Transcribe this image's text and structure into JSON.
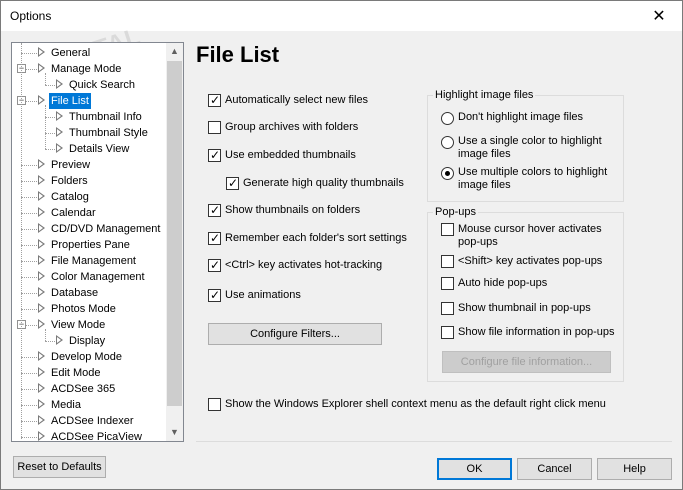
{
  "window": {
    "title": "Options",
    "close_glyph": "✕"
  },
  "watermark": "PORTAL",
  "tree": {
    "items": [
      {
        "label": "General",
        "level": 0
      },
      {
        "label": "Manage Mode",
        "level": 0,
        "expander": "−"
      },
      {
        "label": "Quick Search",
        "level": 1
      },
      {
        "label": "File List",
        "level": 0,
        "expander": "−",
        "selected": true
      },
      {
        "label": "Thumbnail Info",
        "level": 1
      },
      {
        "label": "Thumbnail Style",
        "level": 1
      },
      {
        "label": "Details View",
        "level": 1
      },
      {
        "label": "Preview",
        "level": 0
      },
      {
        "label": "Folders",
        "level": 0
      },
      {
        "label": "Catalog",
        "level": 0
      },
      {
        "label": "Calendar",
        "level": 0
      },
      {
        "label": "CD/DVD Management",
        "level": 0
      },
      {
        "label": "Properties Pane",
        "level": 0
      },
      {
        "label": "File Management",
        "level": 0
      },
      {
        "label": "Color Management",
        "level": 0
      },
      {
        "label": "Database",
        "level": 0
      },
      {
        "label": "Photos Mode",
        "level": 0
      },
      {
        "label": "View Mode",
        "level": 0,
        "expander": "−"
      },
      {
        "label": "Display",
        "level": 1
      },
      {
        "label": "Develop Mode",
        "level": 0
      },
      {
        "label": "Edit Mode",
        "level": 0
      },
      {
        "label": "ACDSee 365",
        "level": 0
      },
      {
        "label": "Media",
        "level": 0
      },
      {
        "label": "ACDSee Indexer",
        "level": 0
      },
      {
        "label": "ACDSee PicaView",
        "level": 0
      }
    ],
    "scroll_up": "▲",
    "scroll_down": "▼"
  },
  "page": {
    "title": "File List"
  },
  "options": {
    "auto_select_new": {
      "label": "Automatically select new files",
      "checked": true
    },
    "group_archives": {
      "label": "Group archives with folders",
      "checked": false
    },
    "embedded_thumbs": {
      "label": "Use embedded thumbnails",
      "checked": true
    },
    "hq_thumbs": {
      "label": "Generate high quality thumbnails",
      "checked": true
    },
    "thumbs_on_folders": {
      "label": "Show thumbnails on folders",
      "checked": true
    },
    "remember_sort": {
      "label": "Remember each folder's sort settings",
      "checked": true
    },
    "ctrl_hot_tracking": {
      "label": "<Ctrl> key activates hot-tracking",
      "checked": true
    },
    "use_animations": {
      "label": "Use animations",
      "checked": true
    },
    "shell_context_menu": {
      "label": "Show the Windows Explorer shell context menu as the default right click menu",
      "checked": false
    }
  },
  "configure_filters_label": "Configure Filters...",
  "highlight_group": {
    "title": "Highlight image files",
    "options": [
      {
        "label": "Don't highlight image files",
        "checked": false
      },
      {
        "label": "Use a single color to highlight",
        "label2": "image files",
        "checked": false
      },
      {
        "label": "Use multiple colors to highlight",
        "label2": "image files",
        "checked": true
      }
    ]
  },
  "popups_group": {
    "title": "Pop-ups",
    "options": [
      {
        "label": "Mouse cursor hover activates",
        "label2": "pop-ups",
        "checked": false
      },
      {
        "label": "<Shift> key activates pop-ups",
        "checked": false
      },
      {
        "label": "Auto hide pop-ups",
        "checked": false
      },
      {
        "label": "Show thumbnail in pop-ups",
        "checked": false
      },
      {
        "label": "Show file information in pop-ups",
        "checked": false
      }
    ],
    "configure_info_label": "Configure file information..."
  },
  "footer": {
    "reset_label": "Reset to Defaults",
    "ok_label": "OK",
    "cancel_label": "Cancel",
    "help_label": "Help"
  }
}
